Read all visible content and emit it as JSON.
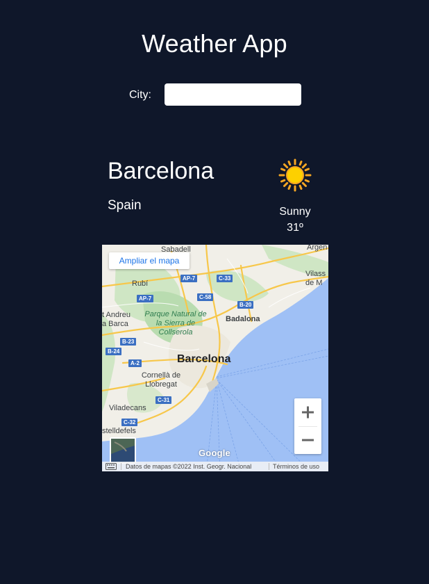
{
  "app": {
    "title": "Weather App"
  },
  "search": {
    "label": "City:",
    "value": "",
    "placeholder": ""
  },
  "weather": {
    "city": "Barcelona",
    "country": "Spain",
    "condition": "Sunny",
    "temperature": "31º",
    "icon": "sun-icon"
  },
  "map": {
    "expand_label": "Ampliar el mapa",
    "zoom_in": "+",
    "zoom_out": "−",
    "logo": "Google",
    "attribution": "Datos de mapas ©2022 Inst. Geogr. Nacional",
    "terms": "Términos de uso",
    "labels": {
      "barcelona": "Barcelona",
      "badalona": "Badalona",
      "rubi": "Rubí",
      "sabadell": "Sabadell",
      "park": "Parque Natural de la Sierra de Collserola",
      "cornella": "Cornellà de Llobregat",
      "viladecans": "Viladecans",
      "castelldefels": "stelldefels",
      "sant_andreu": "t Andreu a Barca",
      "vilassar": "Vilass de M",
      "argentona": "Argen"
    },
    "shields": [
      "AP-7",
      "C-33",
      "AP-7",
      "C-58",
      "B-20",
      "B-23",
      "B-24",
      "A-2",
      "C-31",
      "C-32"
    ]
  },
  "colors": {
    "background": "#0f172a",
    "sea": "#9fc0f5",
    "land": "#f1efe8",
    "park": "#b9dcb0",
    "road": "#f7c74a",
    "shield": "#3b6fc2"
  }
}
